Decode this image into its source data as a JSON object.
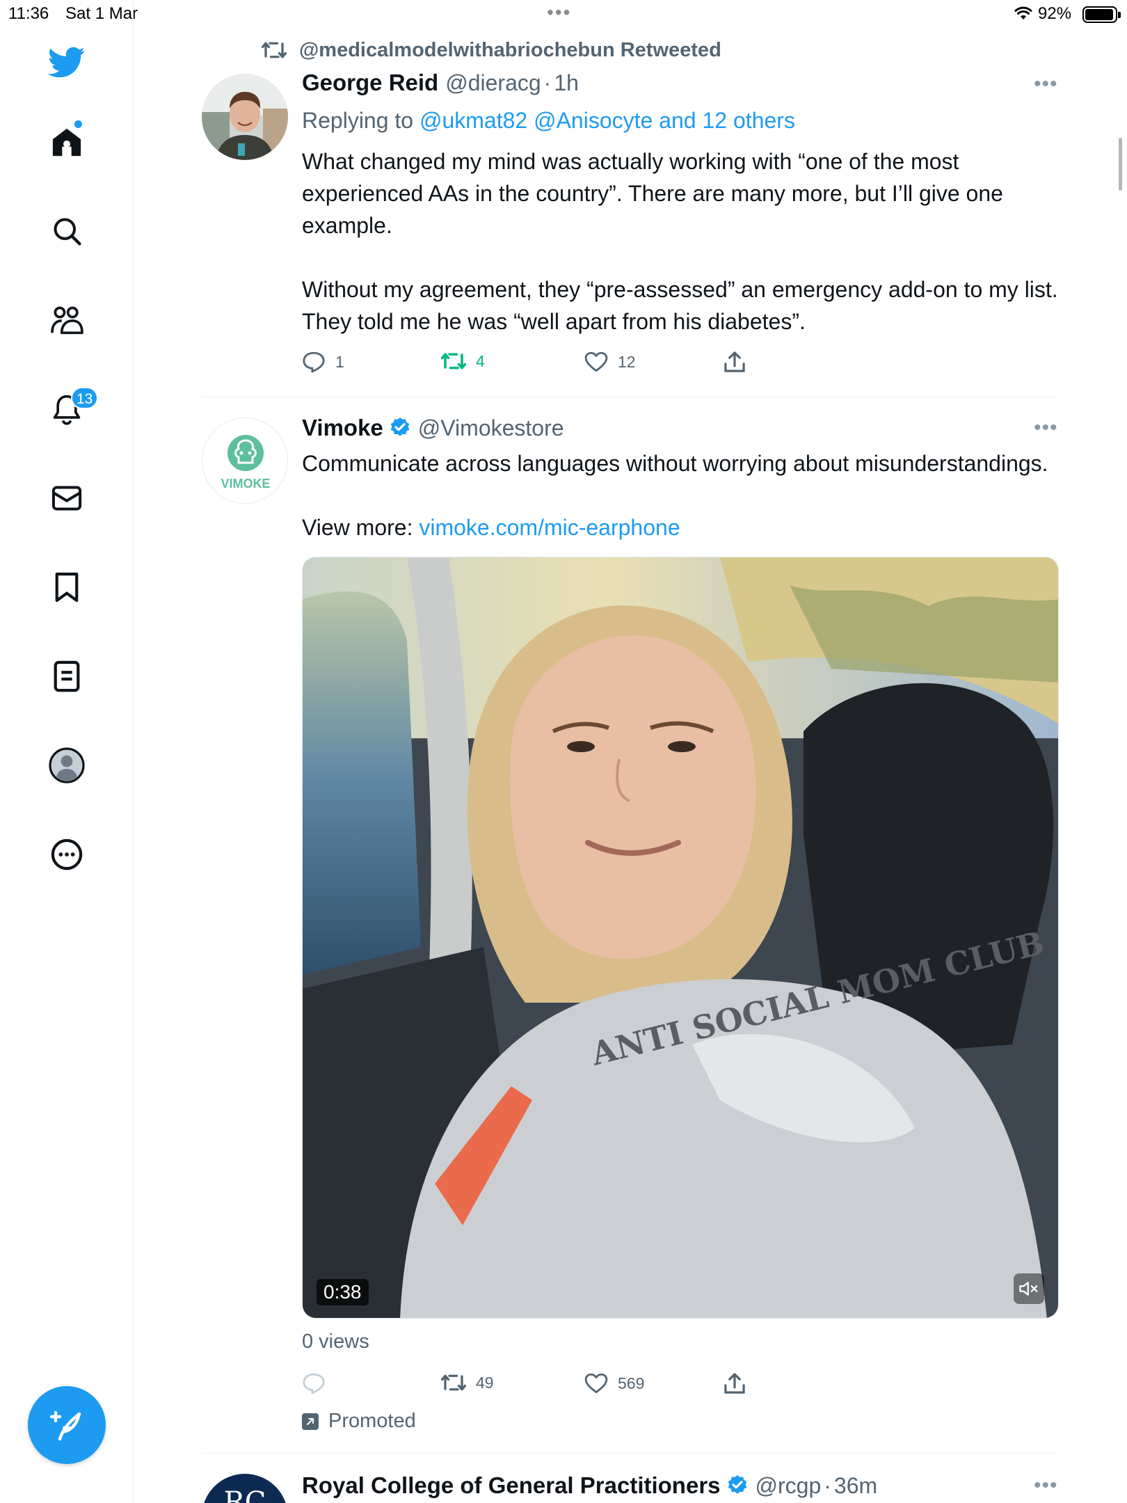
{
  "status_bar": {
    "time": "11:36",
    "date": "Sat 1 Mar",
    "multitask_dots": "•••",
    "battery_percent": "92%",
    "battery_level": 0.92
  },
  "sidebar": {
    "items": [
      {
        "name": "home",
        "icon": "home-icon"
      },
      {
        "name": "explore",
        "icon": "search-icon"
      },
      {
        "name": "communities",
        "icon": "people-icon"
      },
      {
        "name": "notifications",
        "icon": "bell-icon",
        "badge": "13"
      },
      {
        "name": "messages",
        "icon": "mail-icon"
      },
      {
        "name": "bookmarks",
        "icon": "bookmark-icon"
      },
      {
        "name": "lists",
        "icon": "lists-icon"
      },
      {
        "name": "profile",
        "icon": "profile-avatar-icon"
      },
      {
        "name": "more",
        "icon": "more-circle-icon"
      }
    ],
    "accent_color": "#1d9bf0"
  },
  "tweet1": {
    "retweet_label": "@medicalmodelwithabriochebun Retweeted",
    "name": "George Reid",
    "handle": "@dieracg",
    "sep": "·",
    "time": "1h",
    "replying_prefix": "Replying to",
    "replying_to_1": "@ukmat82",
    "replying_to_2": "@Anisocyte",
    "replying_to_rest": "and 12 others",
    "paragraph1": "What changed my mind was actually working with “one of the most experienced AAs in the country”. There are many more, but I’ll give one example.",
    "paragraph2": "Without my agreement, they “pre-assessed” an emergency add-on to my list. They told me he was “well apart from his diabetes”.",
    "replies": "1",
    "retweets": "4",
    "likes": "12"
  },
  "tweet2": {
    "name": "Vimoke",
    "handle": "@Vimokestore",
    "avatar_text": "VIMOKE",
    "text_line": "Communicate across languages without worrying about misunderstandings.",
    "view_more_label": "View more:",
    "link": "vimoke.com/mic-earphone",
    "video_duration": "0:38",
    "video_sweatshirt_text": "ANTI SOCIAL MOM CLUB",
    "views": "0 views",
    "retweets": "49",
    "likes": "569",
    "promoted_label": "Promoted"
  },
  "tweet3": {
    "name": "Royal College of General Practitioners",
    "handle": "@rcgp",
    "sep": "·",
    "time": "36m",
    "avatar_text": "RC"
  }
}
